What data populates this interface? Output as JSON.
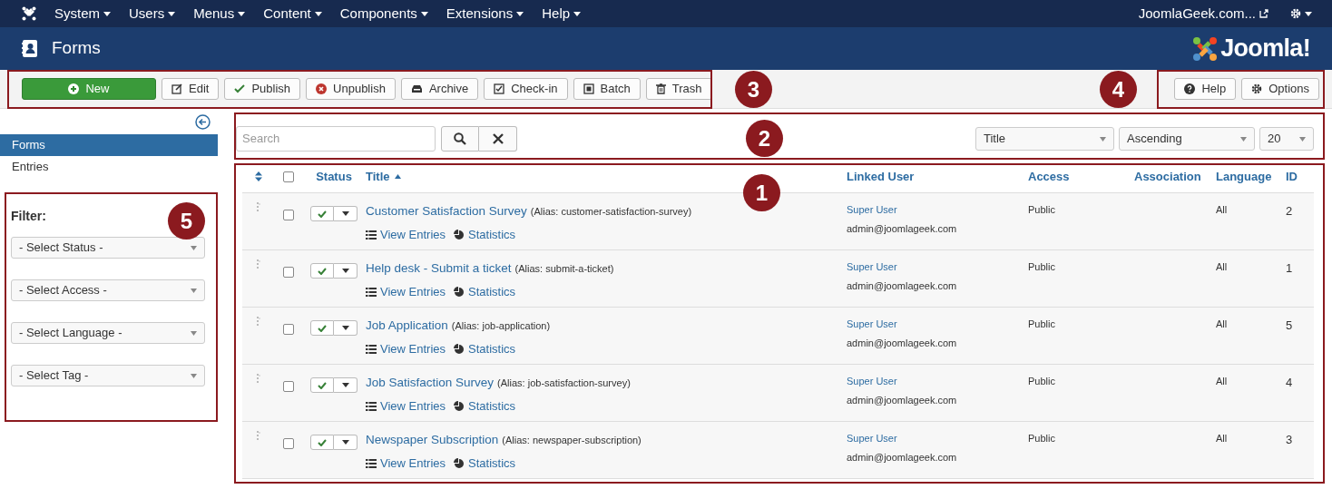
{
  "top_menu": {
    "items": [
      "System",
      "Users",
      "Menus",
      "Content",
      "Components",
      "Extensions",
      "Help"
    ],
    "site_link": "JoomlaGeek.com..."
  },
  "title_bar": {
    "title": "Forms",
    "logo_text": "Joomla!"
  },
  "toolbar": {
    "buttons": [
      {
        "label": "New",
        "kind": "new"
      },
      {
        "label": "Edit",
        "kind": "edit"
      },
      {
        "label": "Publish",
        "kind": "publish"
      },
      {
        "label": "Unpublish",
        "kind": "unpublish"
      },
      {
        "label": "Archive",
        "kind": "archive"
      },
      {
        "label": "Check-in",
        "kind": "checkin"
      },
      {
        "label": "Batch",
        "kind": "batch"
      },
      {
        "label": "Trash",
        "kind": "trash"
      }
    ],
    "right_buttons": [
      {
        "label": "Help",
        "kind": "help"
      },
      {
        "label": "Options",
        "kind": "options"
      }
    ]
  },
  "sidebar": {
    "items": [
      {
        "label": "Forms",
        "selected": true
      },
      {
        "label": "Entries",
        "selected": false
      }
    ],
    "filter_title": "Filter:",
    "filters": [
      "- Select Status -",
      "- Select Access -",
      "- Select Language -",
      "- Select Tag -"
    ]
  },
  "search": {
    "placeholder": "Search"
  },
  "sort": {
    "field": "Title",
    "direction": "Ascending",
    "limit": "20"
  },
  "table": {
    "all_checked": false,
    "columns": [
      "Status",
      "Title",
      "Linked User",
      "Access",
      "Association",
      "Language",
      "ID"
    ],
    "rows": [
      {
        "checked": false,
        "title": "Customer Satisfaction Survey",
        "alias": "(Alias: customer-satisfaction-survey)",
        "published": true,
        "view_entries": "View Entries",
        "statistics": "Statistics",
        "user": "Super User",
        "email": "admin@joomlageek.com",
        "access": "Public",
        "language": "All",
        "id": "2"
      },
      {
        "checked": false,
        "title": "Help desk - Submit a ticket",
        "alias": "(Alias: submit-a-ticket)",
        "published": true,
        "view_entries": "View Entries",
        "statistics": "Statistics",
        "user": "Super User",
        "email": "admin@joomlageek.com",
        "access": "Public",
        "language": "All",
        "id": "1"
      },
      {
        "checked": false,
        "title": "Job Application",
        "alias": "(Alias: job-application)",
        "published": true,
        "view_entries": "View Entries",
        "statistics": "Statistics",
        "user": "Super User",
        "email": "admin@joomlageek.com",
        "access": "Public",
        "language": "All",
        "id": "5"
      },
      {
        "checked": false,
        "title": "Job Satisfaction Survey",
        "alias": "(Alias: job-satisfaction-survey)",
        "published": true,
        "view_entries": "View Entries",
        "statistics": "Statistics",
        "user": "Super User",
        "email": "admin@joomlageek.com",
        "access": "Public",
        "language": "All",
        "id": "4"
      },
      {
        "checked": false,
        "title": "Newspaper Subscription",
        "alias": "(Alias: newspaper-subscription)",
        "published": true,
        "view_entries": "View Entries",
        "statistics": "Statistics",
        "user": "Super User",
        "email": "admin@joomlageek.com",
        "access": "Public",
        "language": "All",
        "id": "3"
      }
    ]
  },
  "annotations": [
    {
      "number": "3"
    },
    {
      "number": "4"
    },
    {
      "number": "2"
    },
    {
      "number": "1"
    },
    {
      "number": "5"
    }
  ]
}
